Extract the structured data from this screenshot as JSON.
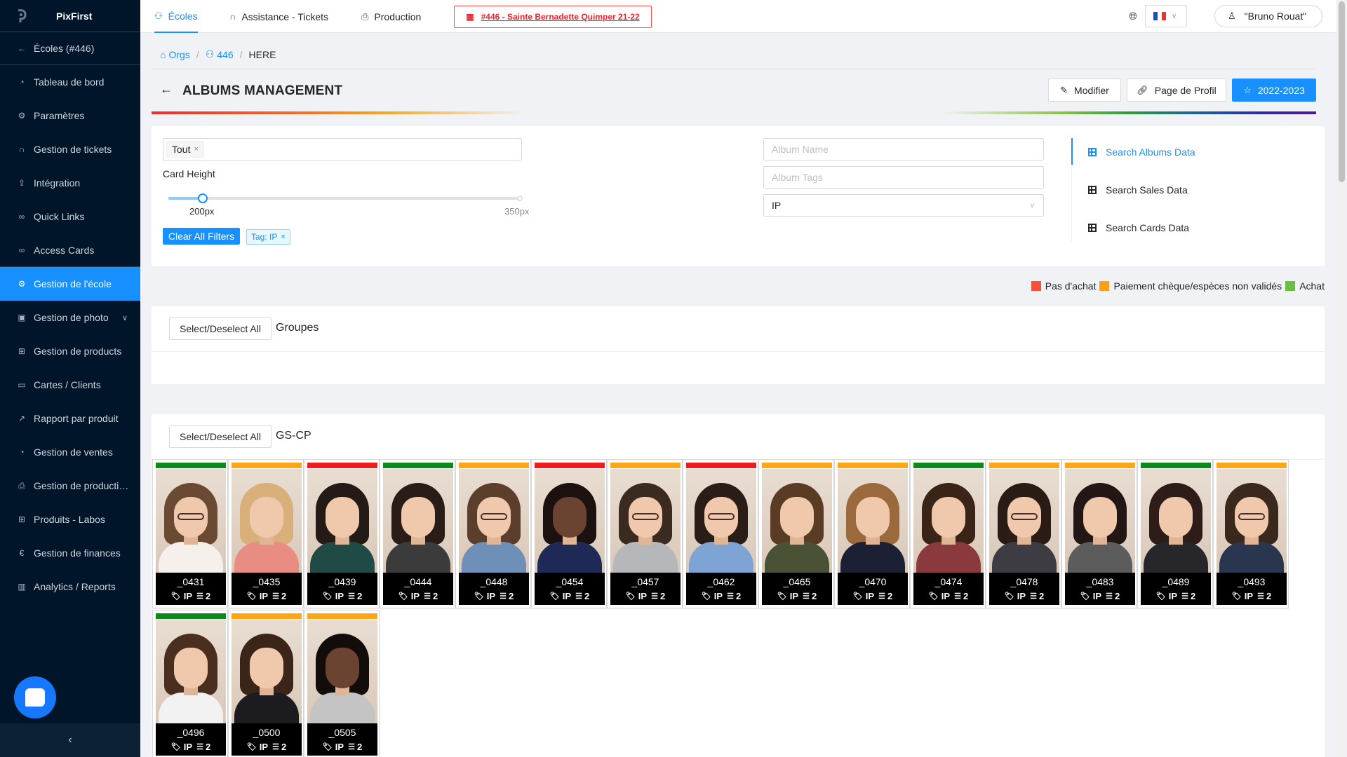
{
  "sidebar": {
    "brand": "PixFirst",
    "back_label": "Écoles (#446)",
    "items": [
      {
        "label": "Tableau de bord",
        "icon": "dashboard-icon"
      },
      {
        "label": "Paramètres",
        "icon": "gear-icon"
      },
      {
        "label": "Gestion de tickets",
        "icon": "headset-icon"
      },
      {
        "label": "Intégration",
        "icon": "rocket-icon"
      },
      {
        "label": "Quick Links",
        "icon": "link-icon"
      },
      {
        "label": "Access Cards",
        "icon": "link-icon"
      },
      {
        "label": "Gestion de l'école",
        "icon": "gear-icon",
        "active": true
      },
      {
        "label": "Gestion de photo",
        "icon": "image-icon",
        "expandable": true
      },
      {
        "label": "Gestion de products",
        "icon": "gift-icon"
      },
      {
        "label": "Cartes / Clients",
        "icon": "card-icon"
      },
      {
        "label": "Rapport par produit",
        "icon": "chart-line-icon"
      },
      {
        "label": "Gestion de ventes",
        "icon": "dashboard-icon"
      },
      {
        "label": "Gestion de producti…",
        "icon": "printer-icon"
      },
      {
        "label": "Produits - Labos",
        "icon": "gift-icon"
      },
      {
        "label": "Gestion de finances",
        "icon": "euro-icon"
      },
      {
        "label": "Analytics / Reports",
        "icon": "bar-chart-icon"
      }
    ]
  },
  "topbar": {
    "nav": [
      {
        "label": "Écoles",
        "icon": "team-icon",
        "active": true
      },
      {
        "label": "Assistance - Tickets",
        "icon": "headset-icon"
      },
      {
        "label": "Production",
        "icon": "printer-icon"
      }
    ],
    "school_tag": "#446 - Sainte Bernadette Quimper 21-22",
    "user_name": "\"Bruno Rouat\""
  },
  "breadcrumb": {
    "orgs": "Orgs",
    "school": "446",
    "current": "HERE"
  },
  "header": {
    "title": "ALBUMS MANAGEMENT",
    "number": "446",
    "edit_label": "Modifier",
    "profile_label": "Page de Profil",
    "year_label": "2022-2023"
  },
  "filters": {
    "selected_tag": "Tout",
    "card_height_label": "Card Height",
    "slider_min_label": "200px",
    "slider_max_label": "350px",
    "slider_value_fraction": 0.0,
    "clear_label": "Clear All Filters",
    "active_tag": "Tag: IP",
    "album_name_placeholder": "Album Name",
    "album_tags_placeholder": "Album Tags",
    "select_value": "IP"
  },
  "search_tabs": [
    {
      "label": "Search Albums Data",
      "active": true
    },
    {
      "label": "Search Sales Data"
    },
    {
      "label": "Search Cards Data"
    }
  ],
  "legend": [
    {
      "label": "Pas d'achat",
      "color": "#f5503c"
    },
    {
      "label": "Paiement chèque/espèces non validés",
      "color": "#ff9f1a"
    },
    {
      "label": "Achat",
      "color": "#6abf40"
    }
  ],
  "groups": [
    {
      "select_label": "Select/Deselect All",
      "name": "Groupes"
    },
    {
      "select_label": "Select/Deselect All",
      "name": "GS-CP"
    }
  ],
  "status_colors": {
    "green": "#0a8a1a",
    "orange": "#ffa617",
    "red": "#ee1c1c"
  },
  "cards": [
    {
      "name": "_0431",
      "tag": "IP",
      "count": "2",
      "status": "green",
      "hair": "#6b4a33",
      "shirt": "#f5f0ec",
      "glasses": true
    },
    {
      "name": "_0435",
      "tag": "IP",
      "count": "2",
      "status": "orange",
      "hair": "#d9b07a",
      "shirt": "#e88c84",
      "glasses": false
    },
    {
      "name": "_0439",
      "tag": "IP",
      "count": "2",
      "status": "red",
      "hair": "#241a16",
      "shirt": "#1f4a45",
      "glasses": false
    },
    {
      "name": "_0444",
      "tag": "IP",
      "count": "2",
      "status": "green",
      "hair": "#2a1d17",
      "shirt": "#3b3b3b",
      "glasses": false
    },
    {
      "name": "_0448",
      "tag": "IP",
      "count": "2",
      "status": "orange",
      "hair": "#5b3e2c",
      "shirt": "#6d8fb8",
      "glasses": true
    },
    {
      "name": "_0454",
      "tag": "IP",
      "count": "2",
      "status": "red",
      "hair": "#1b1210",
      "shirt": "#1e2a55",
      "glasses": false
    },
    {
      "name": "_0457",
      "tag": "IP",
      "count": "2",
      "status": "orange",
      "hair": "#3b2a20",
      "shirt": "#b5b7bb",
      "glasses": true
    },
    {
      "name": "_0462",
      "tag": "IP",
      "count": "2",
      "status": "red",
      "hair": "#2a1c16",
      "shirt": "#7ea4d6",
      "glasses": true
    },
    {
      "name": "_0465",
      "tag": "IP",
      "count": "2",
      "status": "orange",
      "hair": "#5a3b24",
      "shirt": "#4a5236",
      "glasses": false
    },
    {
      "name": "_0470",
      "tag": "IP",
      "count": "2",
      "status": "orange",
      "hair": "#9a6a3d",
      "shirt": "#1b2035",
      "glasses": false
    },
    {
      "name": "_0474",
      "tag": "IP",
      "count": "2",
      "status": "green",
      "hair": "#3a2418",
      "shirt": "#8a3a3d",
      "glasses": false
    },
    {
      "name": "_0478",
      "tag": "IP",
      "count": "2",
      "status": "orange",
      "hair": "#2a1c14",
      "shirt": "#3c3c42",
      "glasses": true
    },
    {
      "name": "_0483",
      "tag": "IP",
      "count": "2",
      "status": "orange",
      "hair": "#221714",
      "shirt": "#5c5c5c",
      "glasses": false
    },
    {
      "name": "_0489",
      "tag": "IP",
      "count": "2",
      "status": "green",
      "hair": "#2d1c17",
      "shirt": "#26262b",
      "glasses": false
    },
    {
      "name": "_0493",
      "tag": "IP",
      "count": "2",
      "status": "orange",
      "hair": "#3a281c",
      "shirt": "#2a3550",
      "glasses": true
    },
    {
      "name": "_0496",
      "tag": "IP",
      "count": "2",
      "status": "green",
      "hair": "#4a2e20",
      "shirt": "#f2f2f2",
      "glasses": false
    },
    {
      "name": "_0500",
      "tag": "IP",
      "count": "2",
      "status": "orange",
      "hair": "#3a2518",
      "shirt": "#1c1c20",
      "glasses": false
    },
    {
      "name": "_0505",
      "tag": "IP",
      "count": "2",
      "status": "orange",
      "hair": "#120c0a",
      "shirt": "#c4c4c4",
      "glasses": false
    }
  ]
}
